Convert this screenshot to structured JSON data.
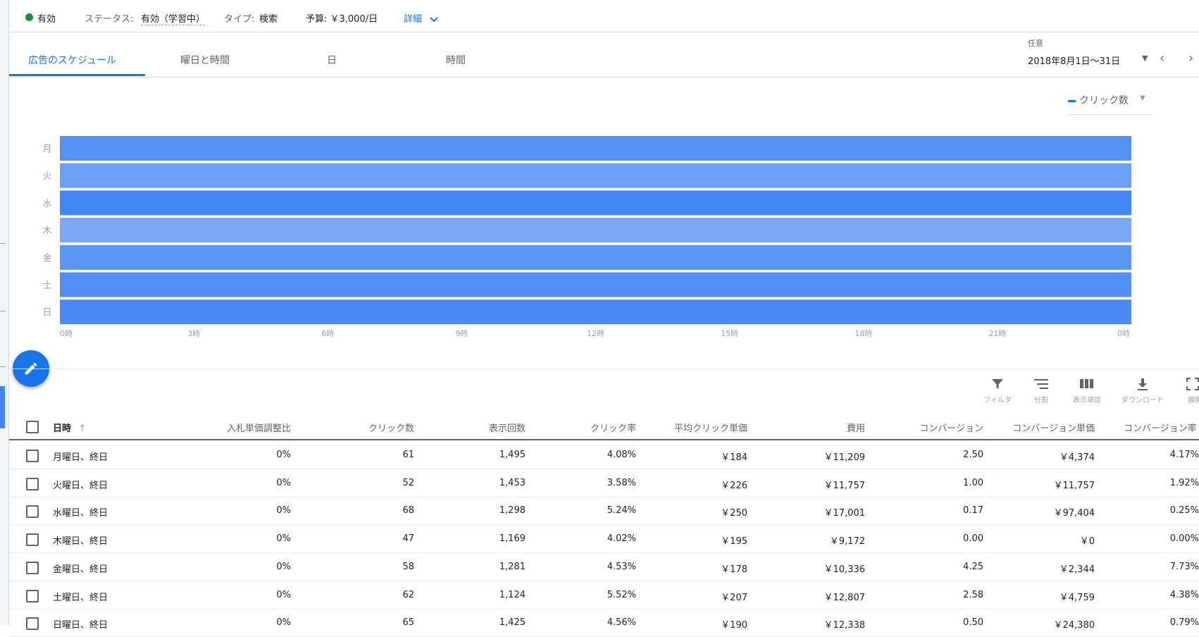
{
  "status_bar": {
    "enabled_label": "有効",
    "status_label": "ステータス:",
    "status_value": "有効（学習中）",
    "type_label": "タイプ:",
    "type_value": "検索",
    "budget": "予算: ￥3,000/日",
    "details_link": "詳細",
    "status_color": "#1e8e3e"
  },
  "tabs": [
    {
      "label": "広告のスケジュール",
      "active": true
    },
    {
      "label": "曜日と時間",
      "active": false
    },
    {
      "label": "日",
      "active": false
    },
    {
      "label": "時間",
      "active": false
    }
  ],
  "date_range": {
    "label": "任意",
    "value": "2018年8月1日～31日"
  },
  "metric_selector": {
    "label": "クリック数",
    "color": "#1a73e8"
  },
  "chart_data": {
    "type": "heatmap",
    "metric": "クリック数",
    "categories": [
      "月",
      "火",
      "水",
      "木",
      "金",
      "土",
      "日"
    ],
    "values": [
      61,
      52,
      68,
      47,
      58,
      62,
      65
    ],
    "x_ticks": [
      "0時",
      "3時",
      "6時",
      "9時",
      "12時",
      "15時",
      "18時",
      "21時",
      "0時"
    ],
    "colors": {
      "high": "#4285f4",
      "low": "#79a8f6"
    }
  },
  "toolbar": [
    {
      "label": "フィルタ",
      "icon": "filter-icon"
    },
    {
      "label": "分割",
      "icon": "segment-icon"
    },
    {
      "label": "表示項目",
      "icon": "columns-icon"
    },
    {
      "label": "ダウンロード",
      "icon": "download-icon"
    },
    {
      "label": "展開",
      "icon": "expand-icon"
    }
  ],
  "table": {
    "columns": [
      "日時",
      "入札単価調整比",
      "クリック数",
      "表示回数",
      "クリック率",
      "平均クリック単価",
      "費用",
      "コンバージョン",
      "コンバージョン単価",
      "コンバージョン率"
    ],
    "sort_indicator": "↑",
    "rows": [
      [
        "月曜日、終日",
        "0%",
        "61",
        "1,495",
        "4.08%",
        "￥184",
        "￥11,209",
        "2.50",
        "￥4,374",
        "4.17%"
      ],
      [
        "火曜日、終日",
        "0%",
        "52",
        "1,453",
        "3.58%",
        "￥226",
        "￥11,757",
        "1.00",
        "￥11,757",
        "1.92%"
      ],
      [
        "水曜日、終日",
        "0%",
        "68",
        "1,298",
        "5.24%",
        "￥250",
        "￥17,001",
        "0.17",
        "￥97,404",
        "0.25%"
      ],
      [
        "木曜日、終日",
        "0%",
        "47",
        "1,169",
        "4.02%",
        "￥195",
        "￥9,172",
        "0.00",
        "￥0",
        "0.00%"
      ],
      [
        "金曜日、終日",
        "0%",
        "58",
        "1,281",
        "4.53%",
        "￥178",
        "￥10,336",
        "4.25",
        "￥2,344",
        "7.73%"
      ],
      [
        "土曜日、終日",
        "0%",
        "62",
        "1,124",
        "5.52%",
        "￥207",
        "￥12,807",
        "2.58",
        "￥4,759",
        "4.38%"
      ],
      [
        "日曜日、終日",
        "0%",
        "65",
        "1,425",
        "4.56%",
        "￥190",
        "￥12,338",
        "0.50",
        "￥24,380",
        "0.79%"
      ]
    ]
  }
}
